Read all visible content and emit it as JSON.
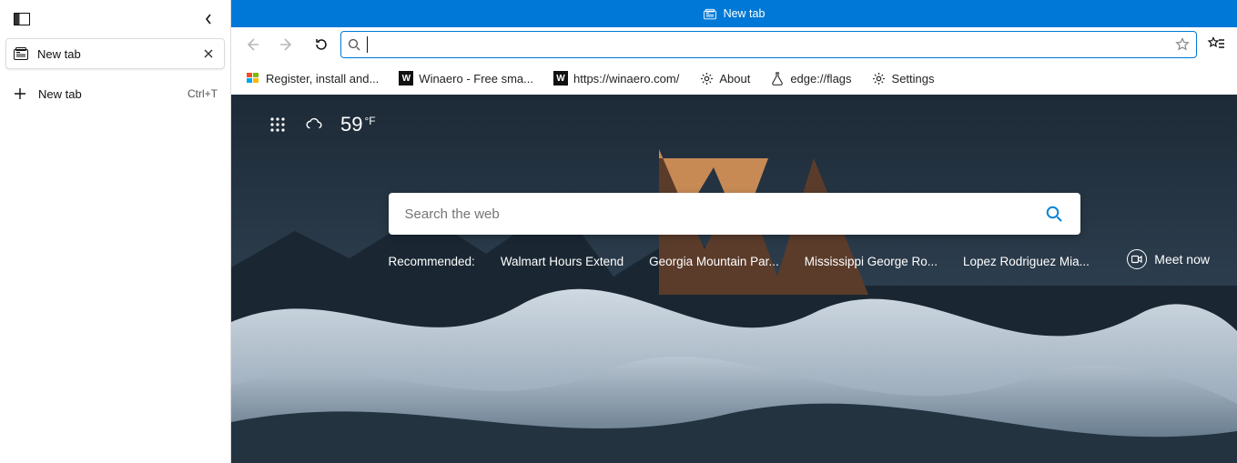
{
  "sidebar": {
    "active_tab": {
      "label": "New tab"
    },
    "new_tab_button": {
      "label": "New tab",
      "shortcut": "Ctrl+T"
    }
  },
  "titlebar": {
    "title": "New tab"
  },
  "toolbar": {
    "address_value": ""
  },
  "favorites": [
    {
      "label": "Register, install and...",
      "icon": "windows"
    },
    {
      "label": "Winaero - Free sma...",
      "icon": "letter-w"
    },
    {
      "label": "https://winaero.com/",
      "icon": "letter-w"
    },
    {
      "label": "About",
      "icon": "gear"
    },
    {
      "label": "edge://flags",
      "icon": "flask"
    },
    {
      "label": "Settings",
      "icon": "gear"
    }
  ],
  "ntp": {
    "temperature": {
      "value": "59",
      "unit": "°F"
    },
    "search_placeholder": "Search the web",
    "recommended_label": "Recommended:",
    "recommended": [
      "Walmart Hours Extend",
      "Georgia Mountain Par...",
      "Mississippi George Ro...",
      "Lopez Rodriguez Mia..."
    ],
    "meet_label": "Meet now"
  }
}
